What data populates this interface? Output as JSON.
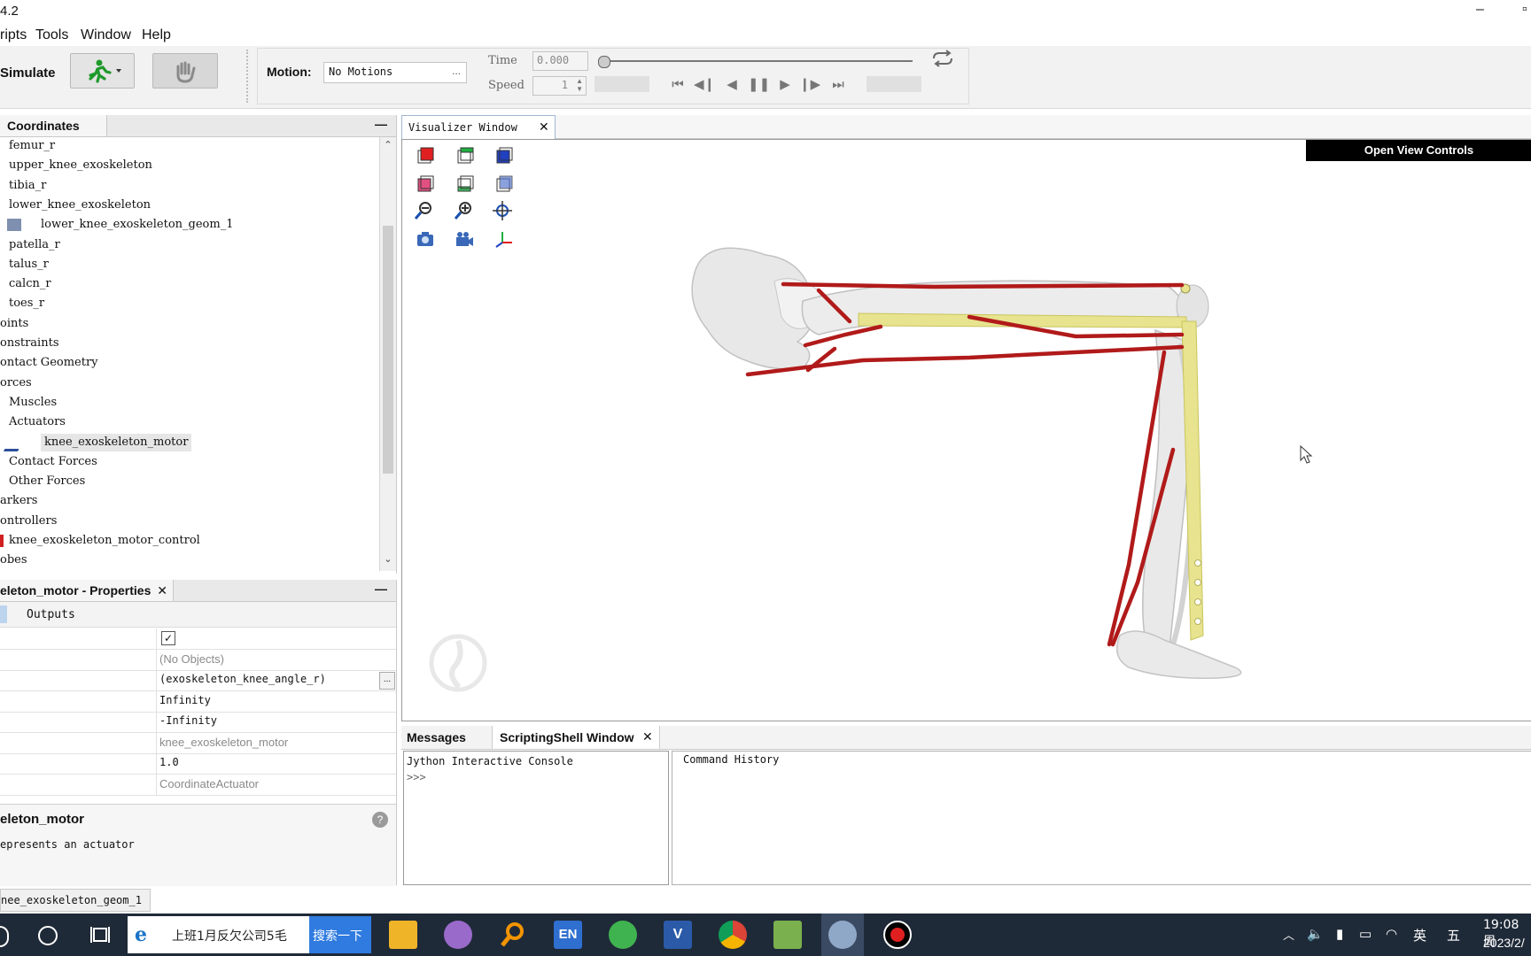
{
  "window": {
    "title": "4.2",
    "minimize_glyph": "–",
    "maximize_glyph": "▫"
  },
  "menu": [
    "ripts",
    "Tools",
    "Window",
    "Help"
  ],
  "toolbar": {
    "simulate_label": "Simulate",
    "motion_label": "Motion:",
    "motion_value": "No Motions",
    "motion_browse": "...",
    "time_label": "Time",
    "time_value": "0.000",
    "speed_label": "Speed",
    "speed_value": "1",
    "loop_icon": "loop-arrows-icon",
    "time_slider_position": 0
  },
  "navigator": {
    "tab_label": "Coordinates",
    "minimize": "—",
    "items": [
      {
        "label": "femur_r",
        "icon": "none"
      },
      {
        "label": "upper_knee_exoskeleton",
        "icon": "none"
      },
      {
        "label": "tibia_r",
        "icon": "none"
      },
      {
        "label": "lower_knee_exoskeleton",
        "icon": "none"
      },
      {
        "label": "lower_knee_exoskeleton_geom_1",
        "icon": "mesh-geometry-icon"
      },
      {
        "label": "patella_r",
        "icon": "none"
      },
      {
        "label": "talus_r",
        "icon": "none"
      },
      {
        "label": "calcn_r",
        "icon": "none"
      },
      {
        "label": "toes_r",
        "icon": "none"
      },
      {
        "label": "oints",
        "icon": "none"
      },
      {
        "label": "onstraints",
        "icon": "none"
      },
      {
        "label": "ontact Geometry",
        "icon": "none"
      },
      {
        "label": "orces",
        "icon": "none"
      },
      {
        "label": "Muscles",
        "icon": "none"
      },
      {
        "label": "Actuators",
        "icon": "none"
      },
      {
        "label": "knee_exoskeleton_motor",
        "icon": "actuator-icon"
      },
      {
        "label": "Contact Forces",
        "icon": "none"
      },
      {
        "label": "Other Forces",
        "icon": "none"
      },
      {
        "label": "arkers",
        "icon": "none"
      },
      {
        "label": "ontrollers",
        "icon": "none"
      },
      {
        "label": "knee_exoskeleton_motor_control",
        "icon": "controller-icon"
      },
      {
        "label": "obes",
        "icon": "none"
      }
    ]
  },
  "properties": {
    "tab_label": "eleton_motor - Properties",
    "minimize": "—",
    "outputs_tab": "Outputs",
    "rows": [
      {
        "value": "",
        "kind": "checkbox"
      },
      {
        "value": "(No Objects)",
        "kind": "gray"
      },
      {
        "value": "(exoskeleton_knee_angle_r)",
        "kind": "mono",
        "browse": "..."
      },
      {
        "value": "Infinity",
        "kind": "mono"
      },
      {
        "value": "-Infinity",
        "kind": "mono"
      },
      {
        "value": "knee_exoskeleton_motor",
        "kind": "gray"
      },
      {
        "value": "1.0",
        "kind": "mono"
      },
      {
        "value": "CoordinateActuator",
        "kind": "gray"
      }
    ],
    "desc_title": "eleton_motor",
    "desc_text": "epresents an actuator",
    "help_glyph": "?",
    "footer_tab": "nee_exoskeleton_geom_1"
  },
  "visualizer": {
    "tab_label": "Visualizer Window",
    "open_view_controls": "Open View Controls",
    "tools": [
      "front-view-icon",
      "top-view-icon",
      "right-view-icon",
      "back-view-icon",
      "bottom-view-icon",
      "left-view-icon",
      "zoom-out-icon",
      "zoom-in-icon",
      "fit-view-icon",
      "snapshot-icon",
      "record-video-icon",
      "axes-icon"
    ]
  },
  "console": {
    "messages_tab": "Messages",
    "scripting_tab": "ScriptingShell Window",
    "console_title": "Jython Interactive Console",
    "prompt": ">>>",
    "history_title": "Command History"
  },
  "taskbar": {
    "search_text": "上班1月反欠公司5毛",
    "search_button": "搜索一下",
    "ime": "英",
    "ime2": "五",
    "en_badge": "EN",
    "time": "19:08 周",
    "date": "2023/2/"
  }
}
